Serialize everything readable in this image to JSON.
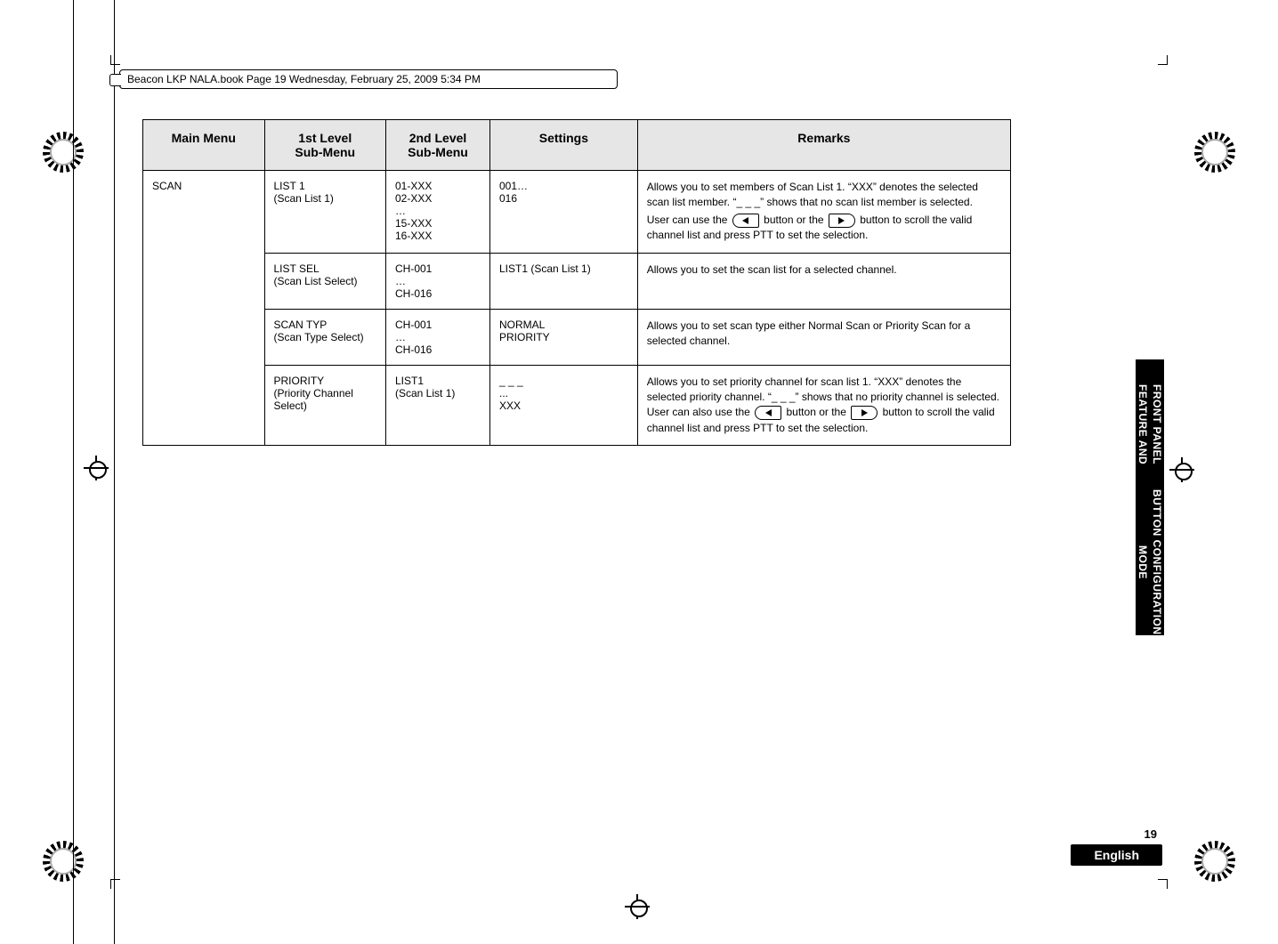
{
  "doc_header": "Beacon LKP NALA.book  Page 19  Wednesday, February 25, 2009  5:34 PM",
  "side_tab_line1": "FRONT PANEL FEATURE AND",
  "side_tab_line2": "BUTTON CONFIGURATION MODE",
  "footer": {
    "page_number": "19",
    "language": "English"
  },
  "headers": {
    "main_menu": "Main Menu",
    "first_level": "1st Level\nSub-Menu",
    "second_level": "2nd Level\nSub-Menu",
    "settings": "Settings",
    "remarks": "Remarks"
  },
  "main_menu_label": "SCAN",
  "rows": [
    {
      "first": {
        "l1": "LIST 1",
        "l2": "(Scan List 1)"
      },
      "second": [
        "01-XXX",
        "02-XXX",
        "…",
        "15-XXX",
        "16-XXX"
      ],
      "settings": [
        "001…",
        "016"
      ],
      "remarks": {
        "pre": "Allows you to set members of Scan List 1. “XXX” denotes the selected scan list member. “_ _ _” shows that no scan list member is selected.",
        "key_prefix": "User can use the ",
        "key_mid": " button or the ",
        "post": " button to scroll the valid channel list and press PTT to set the selection."
      }
    },
    {
      "first": {
        "l1": "LIST SEL",
        "l2": "(Scan List Select)"
      },
      "second": [
        "CH-001",
        "…",
        "CH-016"
      ],
      "settings": [
        "LIST1 (Scan List 1)"
      ],
      "remarks": {
        "plain": "Allows you to set the scan list for a selected channel."
      }
    },
    {
      "first": {
        "l1": "SCAN TYP",
        "l2": "(Scan Type Select)"
      },
      "second": [
        "CH-001",
        "…",
        "CH-016"
      ],
      "settings": [
        "NORMAL",
        "PRIORITY"
      ],
      "remarks": {
        "plain": "Allows you to set scan type either Normal Scan or Priority Scan for a selected channel."
      }
    },
    {
      "first": {
        "l1": "PRIORITY",
        "l2": "(Priority Channel Select)"
      },
      "second": [
        "LIST1",
        "(Scan List 1)"
      ],
      "settings": [
        "_ _ _",
        "...",
        "XXX"
      ],
      "remarks": {
        "pre": "Allows you to set priority channel for scan list 1. “XXX” denotes the selected priority channel. “_ _ _” shows that no priority channel is selected. User can also use the ",
        "key_mid": " button or the ",
        "post": " button to scroll the valid channel list and press PTT to set the selection."
      }
    }
  ]
}
